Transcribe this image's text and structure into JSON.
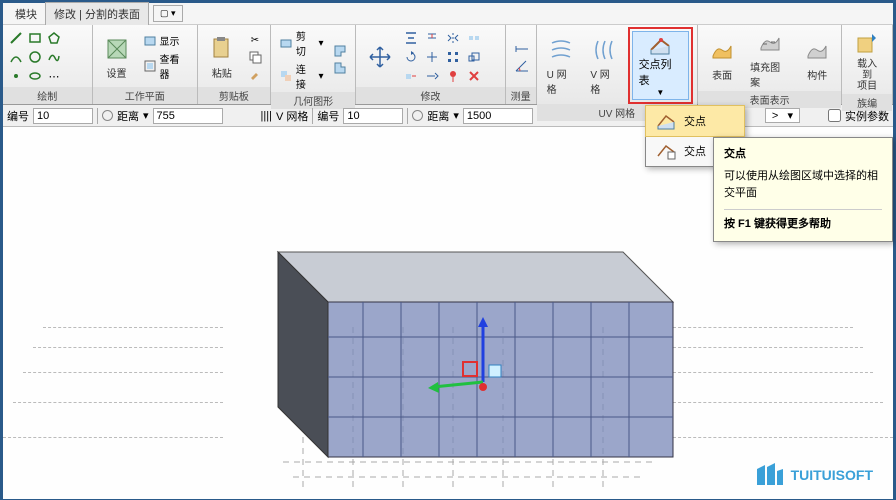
{
  "tabs": {
    "t1": "模块",
    "t2": "修改 | 分割的表面"
  },
  "panels": {
    "draw": "绘制",
    "workplane": "工作平面",
    "clipboard": "剪贴板",
    "geometry": "几何图形",
    "modify": "修改",
    "measure": "测量",
    "uvgrid": "UV 网格",
    "surfacerep": "表面表示",
    "family": "族编"
  },
  "buttons": {
    "settings": "设置",
    "show": "显示",
    "viewer": "查看器",
    "paste": "粘贴",
    "cut": "剪切",
    "connect": "连接",
    "ugrid": "U 网格",
    "vgrid": "V 网格",
    "intersectlist": "交点列表",
    "surface": "表面",
    "fillpattern": "填充图案",
    "component": "构件",
    "loadinto": "载入到\n项目"
  },
  "dropdown": {
    "item1": "交点",
    "item2": "交点"
  },
  "tooltip": {
    "title": "交点",
    "body": "可以使用从绘图区域中选择的相交平面",
    "help": "按 F1 键获得更多帮助"
  },
  "options": {
    "label_num": "编号",
    "val_num1": "10",
    "label_dist": "距离",
    "val_755": "755",
    "label_vgrid": "V 网格",
    "label_num2": "编号",
    "val_num2": "10",
    "label_dist2": "距离",
    "val_1500": "1500",
    "label_instance": "实例参数",
    "gt": ">"
  },
  "watermark": "TUITUISOFT"
}
